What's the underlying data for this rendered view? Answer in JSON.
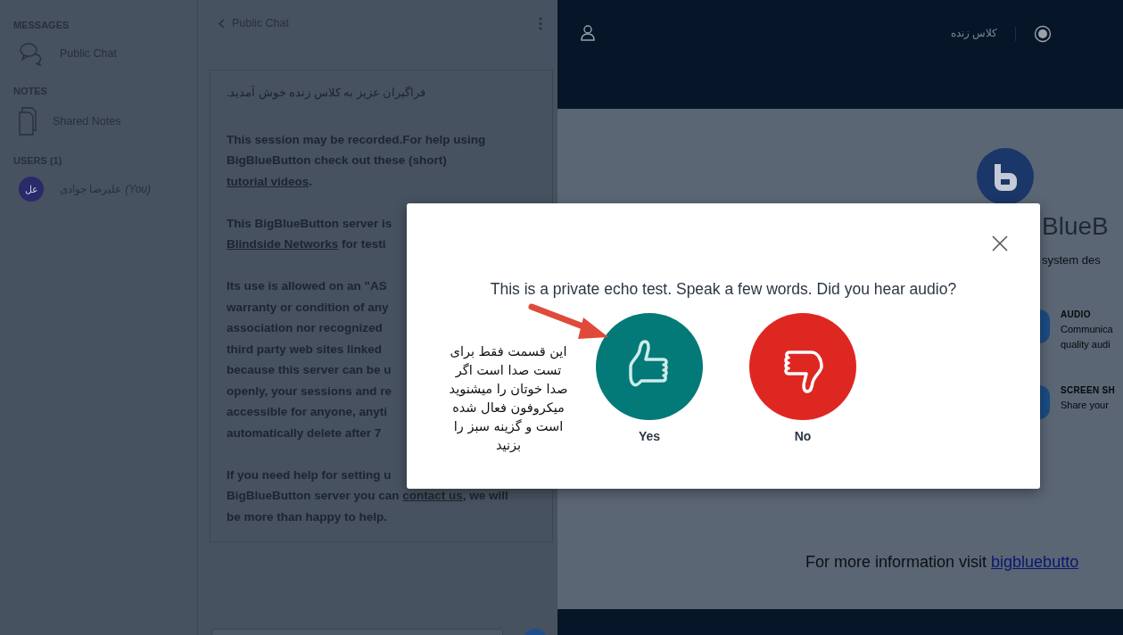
{
  "sidebar": {
    "sections": [
      {
        "heading": "MESSAGES",
        "items": [
          {
            "kind": "chat",
            "label": "Public Chat"
          }
        ]
      },
      {
        "heading": "NOTES",
        "items": [
          {
            "kind": "notes",
            "label": "Shared Notes"
          }
        ]
      },
      {
        "heading": "USERS (1)",
        "items": [
          {
            "kind": "user",
            "initials": "عل",
            "label": "علیرضا جوادی",
            "you": "(You)"
          }
        ]
      }
    ]
  },
  "chat": {
    "title": "Public Chat",
    "paragraphs": [
      {
        "kind": "rtl",
        "text": "فراگیران عزیز به کلاس زنده خوش آمدید."
      },
      {
        "kind": "flow",
        "segments": [
          {
            "kind": "text",
            "text": "This session may be recorded.For help using BigBlueButton check out these (short) "
          },
          {
            "kind": "link",
            "text": "tutorial videos"
          },
          {
            "kind": "text",
            "text": "."
          }
        ]
      },
      {
        "kind": "lines",
        "lines": [
          [
            {
              "kind": "text",
              "text": "This BigBlueButton server is"
            }
          ],
          [
            {
              "kind": "link",
              "text": "Blindside Networks"
            },
            {
              "kind": "text",
              "text": " for testi"
            }
          ]
        ]
      },
      {
        "kind": "lines",
        "lines": [
          [
            {
              "kind": "text",
              "text": "Its use is allowed on an \"AS"
            }
          ],
          [
            {
              "kind": "text",
              "text": "warranty or condition of any"
            }
          ],
          [
            {
              "kind": "text",
              "text": "association nor recognized"
            }
          ],
          [
            {
              "kind": "text",
              "text": "third party web sites linked"
            }
          ],
          [
            {
              "kind": "text",
              "text": "because this server can be u"
            }
          ],
          [
            {
              "kind": "text",
              "text": "openly, your sessions and re"
            }
          ],
          [
            {
              "kind": "text",
              "text": "accessible for anyone, anyti"
            }
          ],
          [
            {
              "kind": "text",
              "text": "automatically delete after 7"
            }
          ]
        ]
      },
      {
        "kind": "lines",
        "lines": [
          [
            {
              "kind": "text",
              "text": "If you need help for setting u"
            }
          ],
          [
            {
              "kind": "text",
              "text": "BigBlueButton server you can "
            },
            {
              "kind": "link",
              "text": "contact us"
            },
            {
              "kind": "text",
              "text": ", we will"
            }
          ],
          [
            {
              "kind": "text",
              "text": "be more than happy to help."
            }
          ]
        ]
      }
    ]
  },
  "header": {
    "title": "کلاس زنده"
  },
  "welcome": {
    "heading": "BlueB",
    "subtitle": "system des",
    "features": [
      {
        "title": "AUDIO",
        "lines": [
          "Communica",
          "quality audi"
        ]
      },
      {
        "title": "SCREEN SH",
        "lines": [
          "Share your"
        ]
      }
    ],
    "footer": "For more information visit ",
    "footer_link": "bigbluebutto"
  },
  "modal": {
    "question": "This is a private echo test. Speak a few words. Did you hear audio?",
    "options": [
      {
        "kind": "yes",
        "label": "Yes"
      },
      {
        "kind": "no",
        "label": "No"
      }
    ],
    "annotation": "این قسمت فقط برای\nتست صدا است اگر\nصدا خوتان را میشنوید\nمیکروفون فعال شده\nاست و گزینه سبز را\nبزنید"
  }
}
